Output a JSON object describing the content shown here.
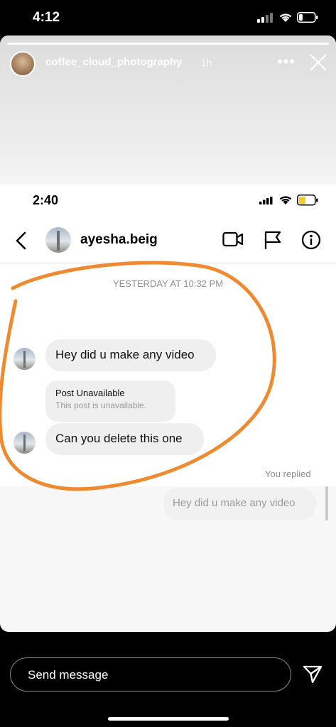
{
  "outer_status": {
    "time": "4:12"
  },
  "story": {
    "username": "coffee_cloud_photography",
    "posted_ago": "1h",
    "more_icon": "more-horizontal-icon",
    "close_icon": "close-icon"
  },
  "screenshot": {
    "status_time": "2:40",
    "contact_name": "ayesha.beig",
    "header_icons": [
      "video-call-icon",
      "flag-icon",
      "info-icon"
    ],
    "timestamp": "YESTERDAY AT 10:32 PM",
    "messages": [
      {
        "text": "Hey did u make any video"
      },
      {
        "title": "Post Unavailable",
        "subtitle": "This post is unavailable."
      },
      {
        "text": "Can you delete this one"
      }
    ],
    "reply_label": "You replied",
    "reply_quote": "Hey did u make any video",
    "annotation_color": "#f08a30"
  },
  "composer": {
    "placeholder": "Send message",
    "send_icon": "send-icon"
  }
}
